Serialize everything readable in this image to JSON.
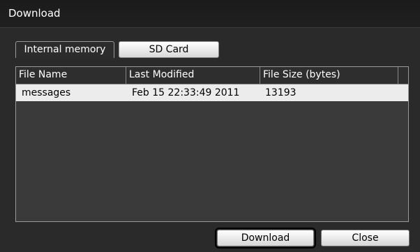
{
  "window": {
    "title": "Download"
  },
  "tabs": [
    {
      "label": "Internal memory",
      "selected": true
    },
    {
      "label": "SD Card",
      "selected": false
    }
  ],
  "table": {
    "columns": [
      "File Name",
      "Last Modified",
      "File Size (bytes)"
    ],
    "rows": [
      {
        "name": "messages",
        "modified": "Feb 15 22:33:49 2011",
        "size": "13193"
      }
    ]
  },
  "buttons": {
    "download": "Download",
    "close": "Close"
  },
  "colors": {
    "background": "#2a2a2a",
    "row": "#ececec",
    "text": "#ffffff"
  }
}
